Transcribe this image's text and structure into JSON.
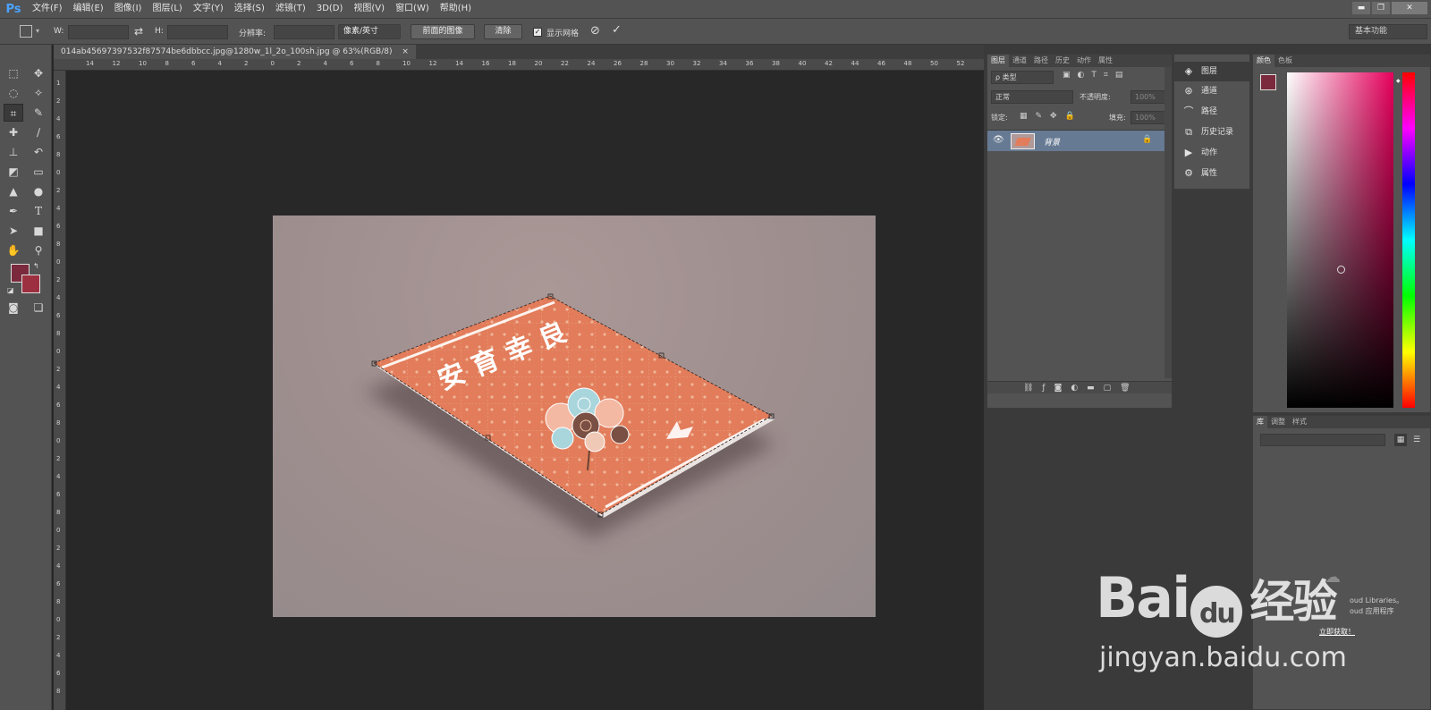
{
  "app": {
    "logo": "Ps"
  },
  "menubar": {
    "items": [
      "文件(F)",
      "编辑(E)",
      "图像(I)",
      "图层(L)",
      "文字(Y)",
      "选择(S)",
      "滤镜(T)",
      "3D(D)",
      "视图(V)",
      "窗口(W)",
      "帮助(H)"
    ]
  },
  "window_controls": {
    "minimize": "▬",
    "restore": "❐",
    "close": "✕"
  },
  "options_bar": {
    "w_label": "W:",
    "h_label": "H:",
    "resolution_label": "分辨率:",
    "unit_select": "像素/英寸",
    "front_image_button": "前面的图像",
    "clear_button": "清除",
    "show_grid_label": "显示网格",
    "show_grid_checked": true,
    "workspace": "基本功能"
  },
  "document": {
    "tab_title": "014ab45697397532f87574be6dbbcc.jpg@1280w_1l_2o_100sh.jpg @ 63%(RGB/8)",
    "close_glyph": "×"
  },
  "ruler": {
    "h_ticks": [
      "14",
      "12",
      "10",
      "8",
      "6",
      "4",
      "2",
      "0",
      "2",
      "4",
      "6",
      "8",
      "10",
      "12",
      "14",
      "16",
      "18",
      "20",
      "22",
      "24",
      "26",
      "28",
      "30",
      "32",
      "34",
      "36",
      "38",
      "40",
      "42",
      "44",
      "46",
      "48",
      "50",
      "52"
    ],
    "v_ticks": [
      "1",
      "2",
      "4",
      "6",
      "8",
      "0",
      "2",
      "4",
      "6",
      "8",
      "0",
      "2",
      "4",
      "6",
      "8",
      "0",
      "2",
      "4",
      "6",
      "8",
      "0",
      "2",
      "4",
      "6",
      "8",
      "0",
      "2",
      "4",
      "6",
      "8",
      "0",
      "2",
      "4",
      "6",
      "8"
    ]
  },
  "card": {
    "title": "安 育 幸 良"
  },
  "layers_panel": {
    "tabs": [
      "图层",
      "通道",
      "路径",
      "历史",
      "动作",
      "属性"
    ],
    "filter_label": "ρ 类型",
    "blend_mode": "正常",
    "opacity_label": "不透明度:",
    "opacity_value": "100%",
    "lock_label": "锁定:",
    "fill_label": "填充:",
    "fill_value": "100%",
    "layer_name": "背景"
  },
  "collapsed_panels": [
    "图层",
    "通道",
    "路径",
    "历史记录",
    "动作",
    "属性"
  ],
  "color_panel": {
    "tabs": [
      "颜色",
      "色板"
    ],
    "fg_color": "#7a2a3c",
    "bg_color": "#9c3040"
  },
  "library_panel": {
    "tabs": [
      "库",
      "调整",
      "样式"
    ],
    "cc_line1": "oud Libraries。",
    "cc_line2": "oud 应用程序",
    "cc_link": "立即获取！"
  },
  "watermark": {
    "brand": "Bai",
    "brand2": "du",
    "suffix": "经验",
    "url": "jingyan.baidu.com"
  }
}
